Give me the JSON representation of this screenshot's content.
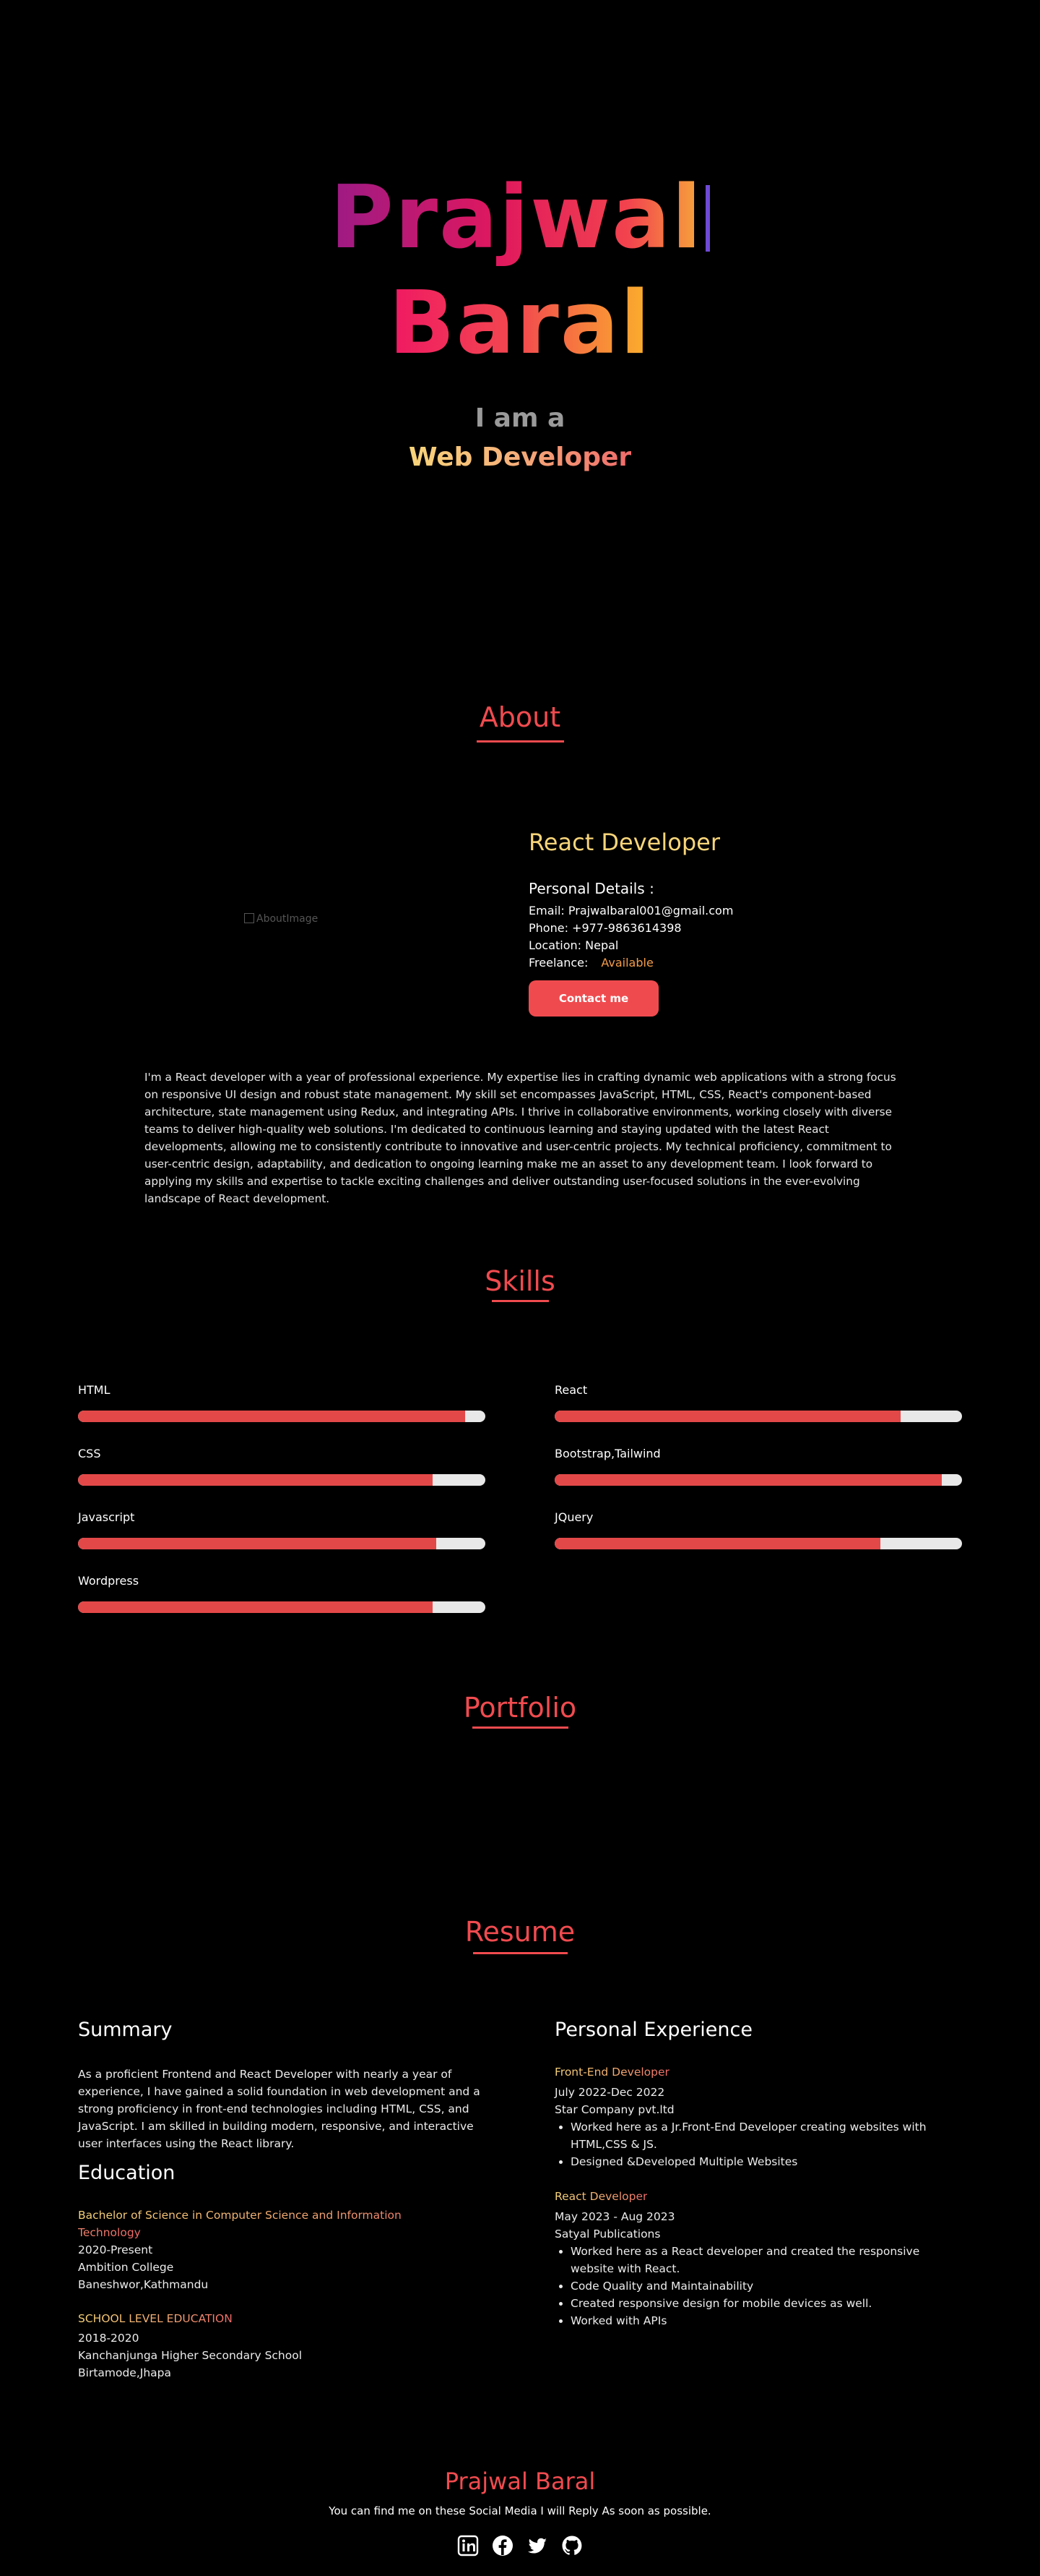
{
  "hero": {
    "name_first": "Prajwal",
    "name_last": "Baral",
    "intro": "I am a",
    "role": "Web Developer"
  },
  "about": {
    "title": "About",
    "image_alt": "AboutImage",
    "role": "React Developer",
    "details_title": "Personal Details :",
    "email": "Email: Prajwalbaral001@gmail.com",
    "phone": "Phone: +977-9863614398",
    "location": "Location: Nepal",
    "freelance_label": "Freelance:",
    "freelance_value": "Available",
    "contact_label": "Contact me",
    "bio": "I'm a React developer with a year of professional experience. My expertise lies in crafting dynamic web applications with a strong focus on responsive UI design and robust state management. My skill set encompasses JavaScript, HTML, CSS, React's component-based architecture, state management using Redux, and integrating APIs. I thrive in collaborative environments, working closely with diverse teams to deliver high-quality web solutions. I'm dedicated to continuous learning and staying updated with the latest React developments, allowing me to consistently contribute to innovative and user-centric projects. My technical proficiency, commitment to user-centric design, adaptability, and dedication to ongoing learning make me an asset to any development team. I look forward to applying my skills and expertise to tackle exciting challenges and deliver outstanding user-focused solutions in the ever-evolving landscape of React development."
  },
  "skills": {
    "title": "Skills",
    "items": [
      {
        "name": "HTML",
        "level": 0.95
      },
      {
        "name": "React",
        "level": 0.85
      },
      {
        "name": "CSS",
        "level": 0.87
      },
      {
        "name": "Bootstrap,Tailwind",
        "level": 0.95
      },
      {
        "name": "Javascript",
        "level": 0.88
      },
      {
        "name": "JQuery",
        "level": 0.8
      },
      {
        "name": "Wordpress",
        "level": 0.87
      }
    ]
  },
  "portfolio": {
    "title": "Portfolio"
  },
  "resume": {
    "title": "Resume",
    "summary_title": "Summary",
    "summary": "As a proficient Frontend and React Developer with nearly a year of experience, I have gained a solid foundation in web development and a strong proficiency in front-end technologies including HTML, CSS, and JavaScript. I am skilled in building modern, responsive, and interactive user interfaces using the React library.",
    "education_title": "Education",
    "education": [
      {
        "degree": "Bachelor of Science in Computer Science and Information Technology",
        "years": "2020-Present",
        "school": "Ambition College",
        "place": "Baneshwor,Kathmandu"
      },
      {
        "degree": "SCHOOL LEVEL EDUCATION",
        "years": "2018-2020",
        "school": "Kanchanjunga Higher Secondary School",
        "place": "Birtamode,Jhapa"
      }
    ],
    "experience_title": "Personal Experience",
    "experience": [
      {
        "role": "Front-End Developer",
        "period": "July 2022-Dec 2022",
        "company": "Star Company pvt.ltd",
        "points": [
          "Worked here as a Jr.Front-End Developer creating websites with HTML,CSS & JS.",
          "Designed &Developed Multiple Websites"
        ]
      },
      {
        "role": "React Developer",
        "period": "May 2023 - Aug 2023",
        "company": "Satyal Publications",
        "points": [
          "Worked here as a React developer and created the responsive website with React.",
          "Code Quality and Maintainability",
          "Created responsive design for mobile devices as well.",
          "Worked with APIs"
        ]
      }
    ]
  },
  "footer": {
    "name": "Prajwal Baral",
    "text": "You can find me on these Social Media I will Reply As soon as possible.",
    "social": [
      "linkedin-icon",
      "facebook-icon",
      "twitter-icon",
      "github-icon"
    ]
  },
  "colors": {
    "accent": "#f04b4f",
    "gold": "#f8d57a",
    "bar": "#e34848",
    "track": "#e8e8e8"
  }
}
